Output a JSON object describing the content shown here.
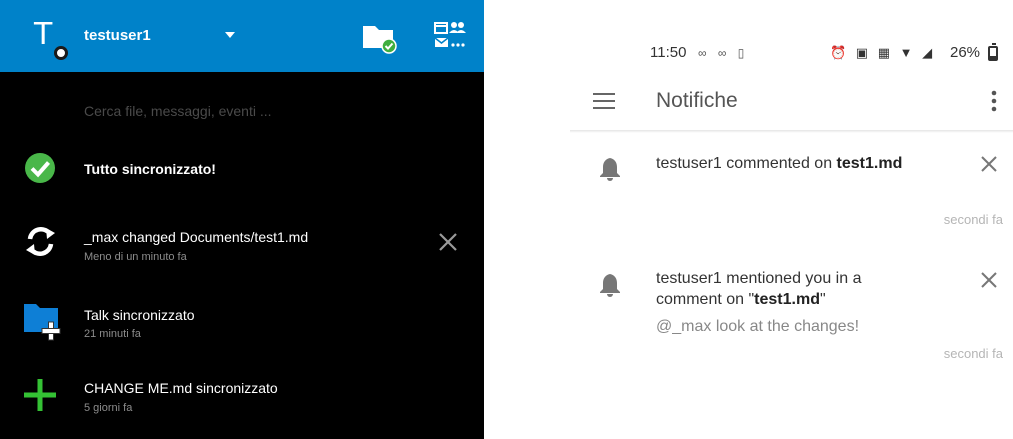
{
  "desktop": {
    "header": {
      "avatar_letter": "T",
      "username": "testuser1",
      "accent": "#0082c9"
    },
    "search": {
      "placeholder": "Cerca file, messaggi, eventi ..."
    },
    "activities": [
      {
        "icon": "check-circle-icon",
        "title": "Tutto sincronizzato!",
        "subtitle": ""
      },
      {
        "icon": "sync-icon",
        "title": "_max changed Documents/test1.md",
        "subtitle": "Meno di un minuto fa"
      },
      {
        "icon": "folder-add-icon",
        "title": "Talk sincronizzato",
        "subtitle": "21 minuti fa"
      },
      {
        "icon": "plus-icon",
        "title": "CHANGE ME.md sincronizzato",
        "subtitle": "5 giorni fa"
      }
    ]
  },
  "phone": {
    "status_bar": {
      "time": "11:50",
      "battery": "26%",
      "battery_level": 0.26
    },
    "toolbar": {
      "title": "Notifiche"
    },
    "notifications": [
      {
        "user": "testuser1",
        "action": " commented on ",
        "file": "test1.md",
        "message": "",
        "time": "secondi fa"
      },
      {
        "user": "testuser1",
        "action": " mentioned you in a comment on \"",
        "file": "test1.md",
        "suffix": "\"",
        "message": "@_max look at the changes!",
        "time": "secondi fa"
      }
    ]
  }
}
